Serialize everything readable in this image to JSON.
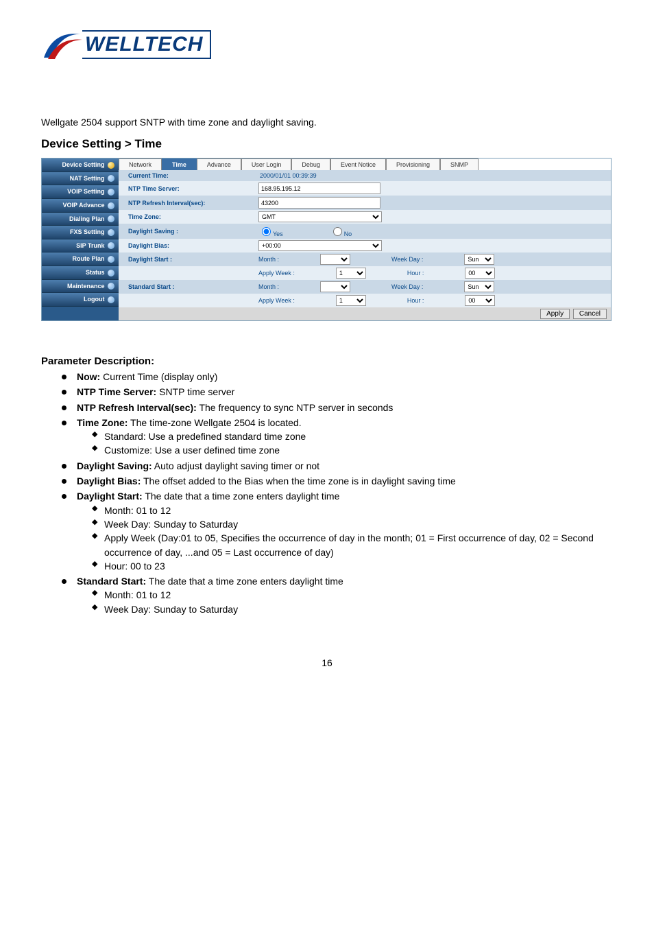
{
  "logo_text": "WELLTECH",
  "intro": "Wellgate 2504 support SNTP with time zone and daylight saving.",
  "heading": "Device Setting > Time",
  "sidebar": {
    "items": [
      {
        "label": "Device Setting",
        "expanded": true
      },
      {
        "label": "NAT Setting"
      },
      {
        "label": "VOIP Setting"
      },
      {
        "label": "VOIP Advance"
      },
      {
        "label": "Dialing Plan"
      },
      {
        "label": "FXS Setting"
      },
      {
        "label": "SIP Trunk"
      },
      {
        "label": "Route Plan"
      },
      {
        "label": "Status"
      },
      {
        "label": "Maintenance"
      },
      {
        "label": "Logout"
      }
    ]
  },
  "tabs": [
    "Network",
    "Time",
    "Advance",
    "User Login",
    "Debug",
    "Event Notice",
    "Provisioning",
    "SNMP"
  ],
  "active_tab": "Time",
  "form": {
    "current_time_label": "Current Time:",
    "current_time_value": "2000/01/01 00:39:39",
    "ntp_server_label": "NTP Time Server:",
    "ntp_server_value": "168.95.195.12",
    "ntp_refresh_label": "NTP Refresh Interval(sec):",
    "ntp_refresh_value": "43200",
    "timezone_label": "Time Zone:",
    "timezone_value": "GMT",
    "daylight_saving_label": "Daylight Saving :",
    "radio_yes": "Yes",
    "radio_no": "No",
    "daylight_bias_label": "Daylight Bias:",
    "daylight_bias_value": "+00:00",
    "daylight_start_label": "Daylight Start :",
    "standard_start_label": "Standard Start :",
    "month_label": "Month :",
    "apply_week_label": "Apply Week :",
    "week_day_label": "Week Day :",
    "hour_label": "Hour :",
    "month_blank": "",
    "apply_week_value": "1",
    "weekday_value": "Sun",
    "hour_value": "00",
    "apply_btn": "Apply",
    "cancel_btn": "Cancel"
  },
  "param_heading": "Parameter Description:",
  "params": {
    "now_b": "Now:",
    "now_t": " Current Time (display only)",
    "ntpserver_b": "NTP Time Server:",
    "ntpserver_t": " SNTP time server",
    "ntprefresh_b": "NTP Refresh Interval(sec):",
    "ntprefresh_t": " The frequency to sync NTP server in seconds",
    "tz_b": "Time Zone:",
    "tz_t": " The time-zone Wellgate 2504 is located.",
    "tz_s1": "Standard: Use a predefined standard time zone",
    "tz_s2": "Customize: Use a user defined time zone",
    "ds_b": "Daylight Saving:",
    "ds_t": " Auto adjust daylight saving timer or not",
    "db_b": "Daylight Bias:",
    "db_t": " The offset added to the Bias when the time zone is in daylight saving time",
    "dstart_b": "Daylight Start:",
    "dstart_t": " The date that a time zone enters daylight time",
    "dstart_s1": "Month: 01 to 12",
    "dstart_s2": "Week Day: Sunday to Saturday",
    "dstart_s3a": "Apply Week (Day:01 to 05, Specifies the occurrence of day in the month; 01 = First occurrence of day, 02 = Second occurrence of day, ...and 05 = Last occurrence of day)",
    "dstart_s4": "Hour: 00 to 23",
    "sstart_b": "Standard Start:",
    "sstart_t": " The date that a time zone enters daylight time",
    "sstart_s1": "Month: 01 to 12",
    "sstart_s2": "Week Day: Sunday to Saturday"
  },
  "page_number": "16"
}
